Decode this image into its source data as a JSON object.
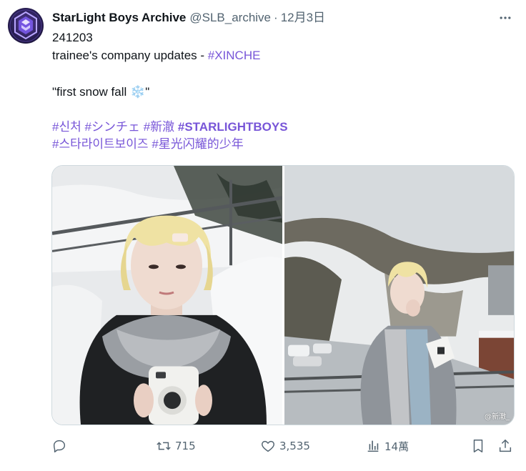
{
  "tweet": {
    "author_name": "StarLight Boys Archive",
    "handle": "@SLB_archive",
    "separator": "·",
    "date": "12月3日",
    "lines": {
      "line1": "241203",
      "line2_text": "trainee's company updates - ",
      "line2_tag": "#XINCHE",
      "quote_open": "\"first snow fall ",
      "quote_emoji": "❄️",
      "quote_close": "\"",
      "tags1": [
        "#신처",
        "#シンチェ",
        "#新澈",
        "#STARLIGHTBOYS"
      ],
      "tags2": [
        "#스타라이트보이즈",
        "#星光闪耀的少年"
      ]
    },
    "media": {
      "watermark": "@新澈_"
    },
    "actions": {
      "reply_count": "",
      "retweet_count": "715",
      "like_count": "3,535",
      "views_count": "14萬"
    }
  },
  "colors": {
    "hashtag": "#7856d8",
    "muted": "#536471",
    "text": "#0f1419"
  },
  "icons": {
    "avatar": "starlight-logo",
    "more": "ellipsis-icon",
    "reply": "reply-icon",
    "retweet": "retweet-icon",
    "like": "heart-icon",
    "views": "views-icon",
    "bookmark": "bookmark-icon",
    "share": "share-icon"
  }
}
